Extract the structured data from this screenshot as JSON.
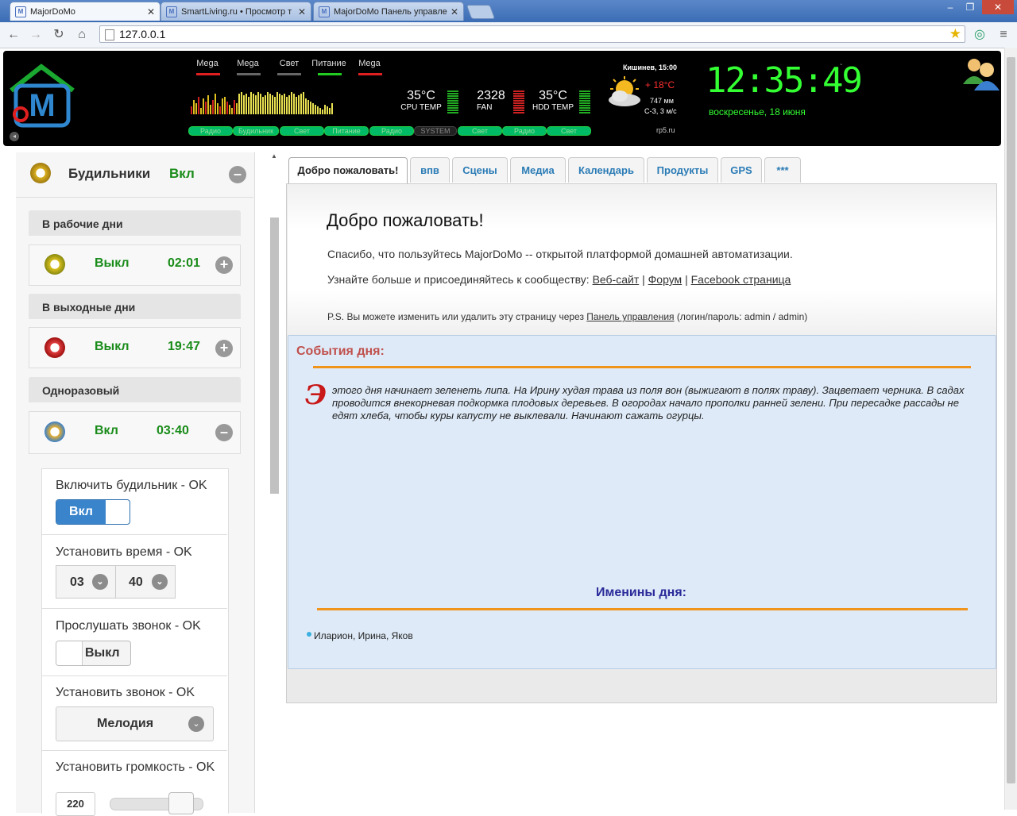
{
  "browser": {
    "tabs": [
      {
        "title": "MajorDoMo",
        "active": true
      },
      {
        "title": "SmartLiving.ru • Просмотр т",
        "active": false
      },
      {
        "title": "MajorDoMo Панель управле",
        "active": false
      }
    ],
    "url": "127.0.0.1",
    "window_buttons": [
      "–",
      "❐",
      "✕"
    ]
  },
  "header": {
    "logo_letter": "M",
    "top_labels": [
      {
        "label": "Mega",
        "color": "#e02020"
      },
      {
        "label": "Mega",
        "color": "#666666"
      },
      {
        "label": "Свет",
        "color": "#666666"
      },
      {
        "label": "Питание",
        "color": "#22cc22"
      },
      {
        "label": "Mega",
        "color": "#e02020"
      }
    ],
    "stats": [
      {
        "value": "35°C",
        "label": "CPU TEMP",
        "level": 10,
        "color": "#22aa22"
      },
      {
        "value": "2328",
        "label": "FAN",
        "level": 10,
        "color": "#cc2222"
      },
      {
        "value": "35°C",
        "label": "HDD TEMP",
        "level": 10,
        "color": "#22aa22"
      }
    ],
    "pills": [
      {
        "label": "Радио",
        "state": "on"
      },
      {
        "label": "Будильник",
        "state": "on"
      },
      {
        "label": "Свет",
        "state": "on"
      },
      {
        "label": "Питание",
        "state": "on"
      },
      {
        "label": "Радио",
        "state": "on"
      },
      {
        "label": "SYSTEM",
        "state": "off"
      },
      {
        "label": "Свет",
        "state": "on"
      },
      {
        "label": "Радио",
        "state": "on"
      },
      {
        "label": "Свет",
        "state": "on"
      }
    ],
    "weather": {
      "city_time": "Кишинев, 15:00",
      "temp": "+ 18°C",
      "pressure": "747 мм",
      "wind": "С-З, 3 м/с",
      "source": "rp5.ru"
    },
    "clock": "12:35:49",
    "date": "воскресенье,  18 июня",
    "hyphen": "-"
  },
  "alarms": {
    "title": "Будильники",
    "state": "Вкл",
    "groups": [
      {
        "name": "В рабочие дни",
        "state": "Выкл",
        "time": "02:01",
        "action": "+"
      },
      {
        "name": "В выходные дни",
        "state": "Выкл",
        "time": "19:47",
        "action": "+"
      },
      {
        "name": "Одноразовый",
        "state": "Вкл",
        "time": "03:40",
        "action": "–"
      }
    ],
    "settings": {
      "enable_label": "Включить будильник - OK",
      "enable_value": "Вкл",
      "time_label": "Установить время - OK",
      "hour": "03",
      "minute": "40",
      "listen_label": "Прослушать звонок - OK",
      "listen_value": "Выкл",
      "ring_label": "Установить звонок - OK",
      "ring_value": "Мелодия",
      "volume_label": "Установить громкость - OK",
      "volume_value": "220"
    }
  },
  "tabs": [
    {
      "label": "Добро пожаловать!",
      "active": true
    },
    {
      "label": "впв"
    },
    {
      "label": "Сцены"
    },
    {
      "label": "Медиа"
    },
    {
      "label": "Календарь"
    },
    {
      "label": "Продукты"
    },
    {
      "label": "GPS"
    },
    {
      "label": "***"
    }
  ],
  "welcome": {
    "heading": "Добро пожаловать!",
    "line1": "Спасибо, что пользуйтесь MajorDoMo -- открытой платформой домашней автоматизации.",
    "line2_prefix": "Узнайте больше и присоединяйтесь к сообществу: ",
    "link_site": "Веб-сайт",
    "link_forum": "Форум",
    "link_fb": "Facebook страница",
    "sep": " | ",
    "ps_prefix": "P.S. Вы можете изменить или удалить эту страницу через ",
    "ps_link": "Панель управления",
    "ps_suffix": " (логин/пароль: admin / admin)"
  },
  "events": {
    "title": "События дня:",
    "dropcap": "Э",
    "text": "этого дня начинает зеленеть липа. На Ирину худая трава из поля вон (выжигают в полях траву). Зацветает черника. В садах проводится внекорневая подкормка плодовых деревьев. В огородах начало прополки ранней зелени. При пересадке рассады не едят хлеба, чтобы куры капусту не выклевали. Начинают сажать огурцы.",
    "names_title": "Именины дня:",
    "names": "Иларион, Ирина, Яков"
  }
}
